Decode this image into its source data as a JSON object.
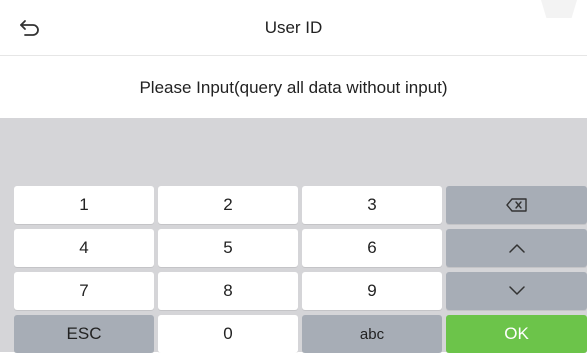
{
  "header": {
    "title": "User ID",
    "back_icon": "back-arrow-icon"
  },
  "prompt": {
    "text": "Please Input(query all data without input)"
  },
  "input": {
    "value": ""
  },
  "keypad": {
    "rows": [
      [
        "1",
        "2",
        "3"
      ],
      [
        "4",
        "5",
        "6"
      ],
      [
        "7",
        "8",
        "9"
      ]
    ],
    "esc_label": "ESC",
    "zero_label": "0",
    "abc_label": "abc",
    "ok_label": "OK",
    "backspace_icon": "backspace-icon",
    "up_icon": "chevron-up-icon",
    "down_icon": "chevron-down-icon"
  },
  "colors": {
    "keyboard_bg": "#d5d5d8",
    "key_white": "#ffffff",
    "key_gray": "#a7adb6",
    "ok_green": "#6cc44a"
  }
}
